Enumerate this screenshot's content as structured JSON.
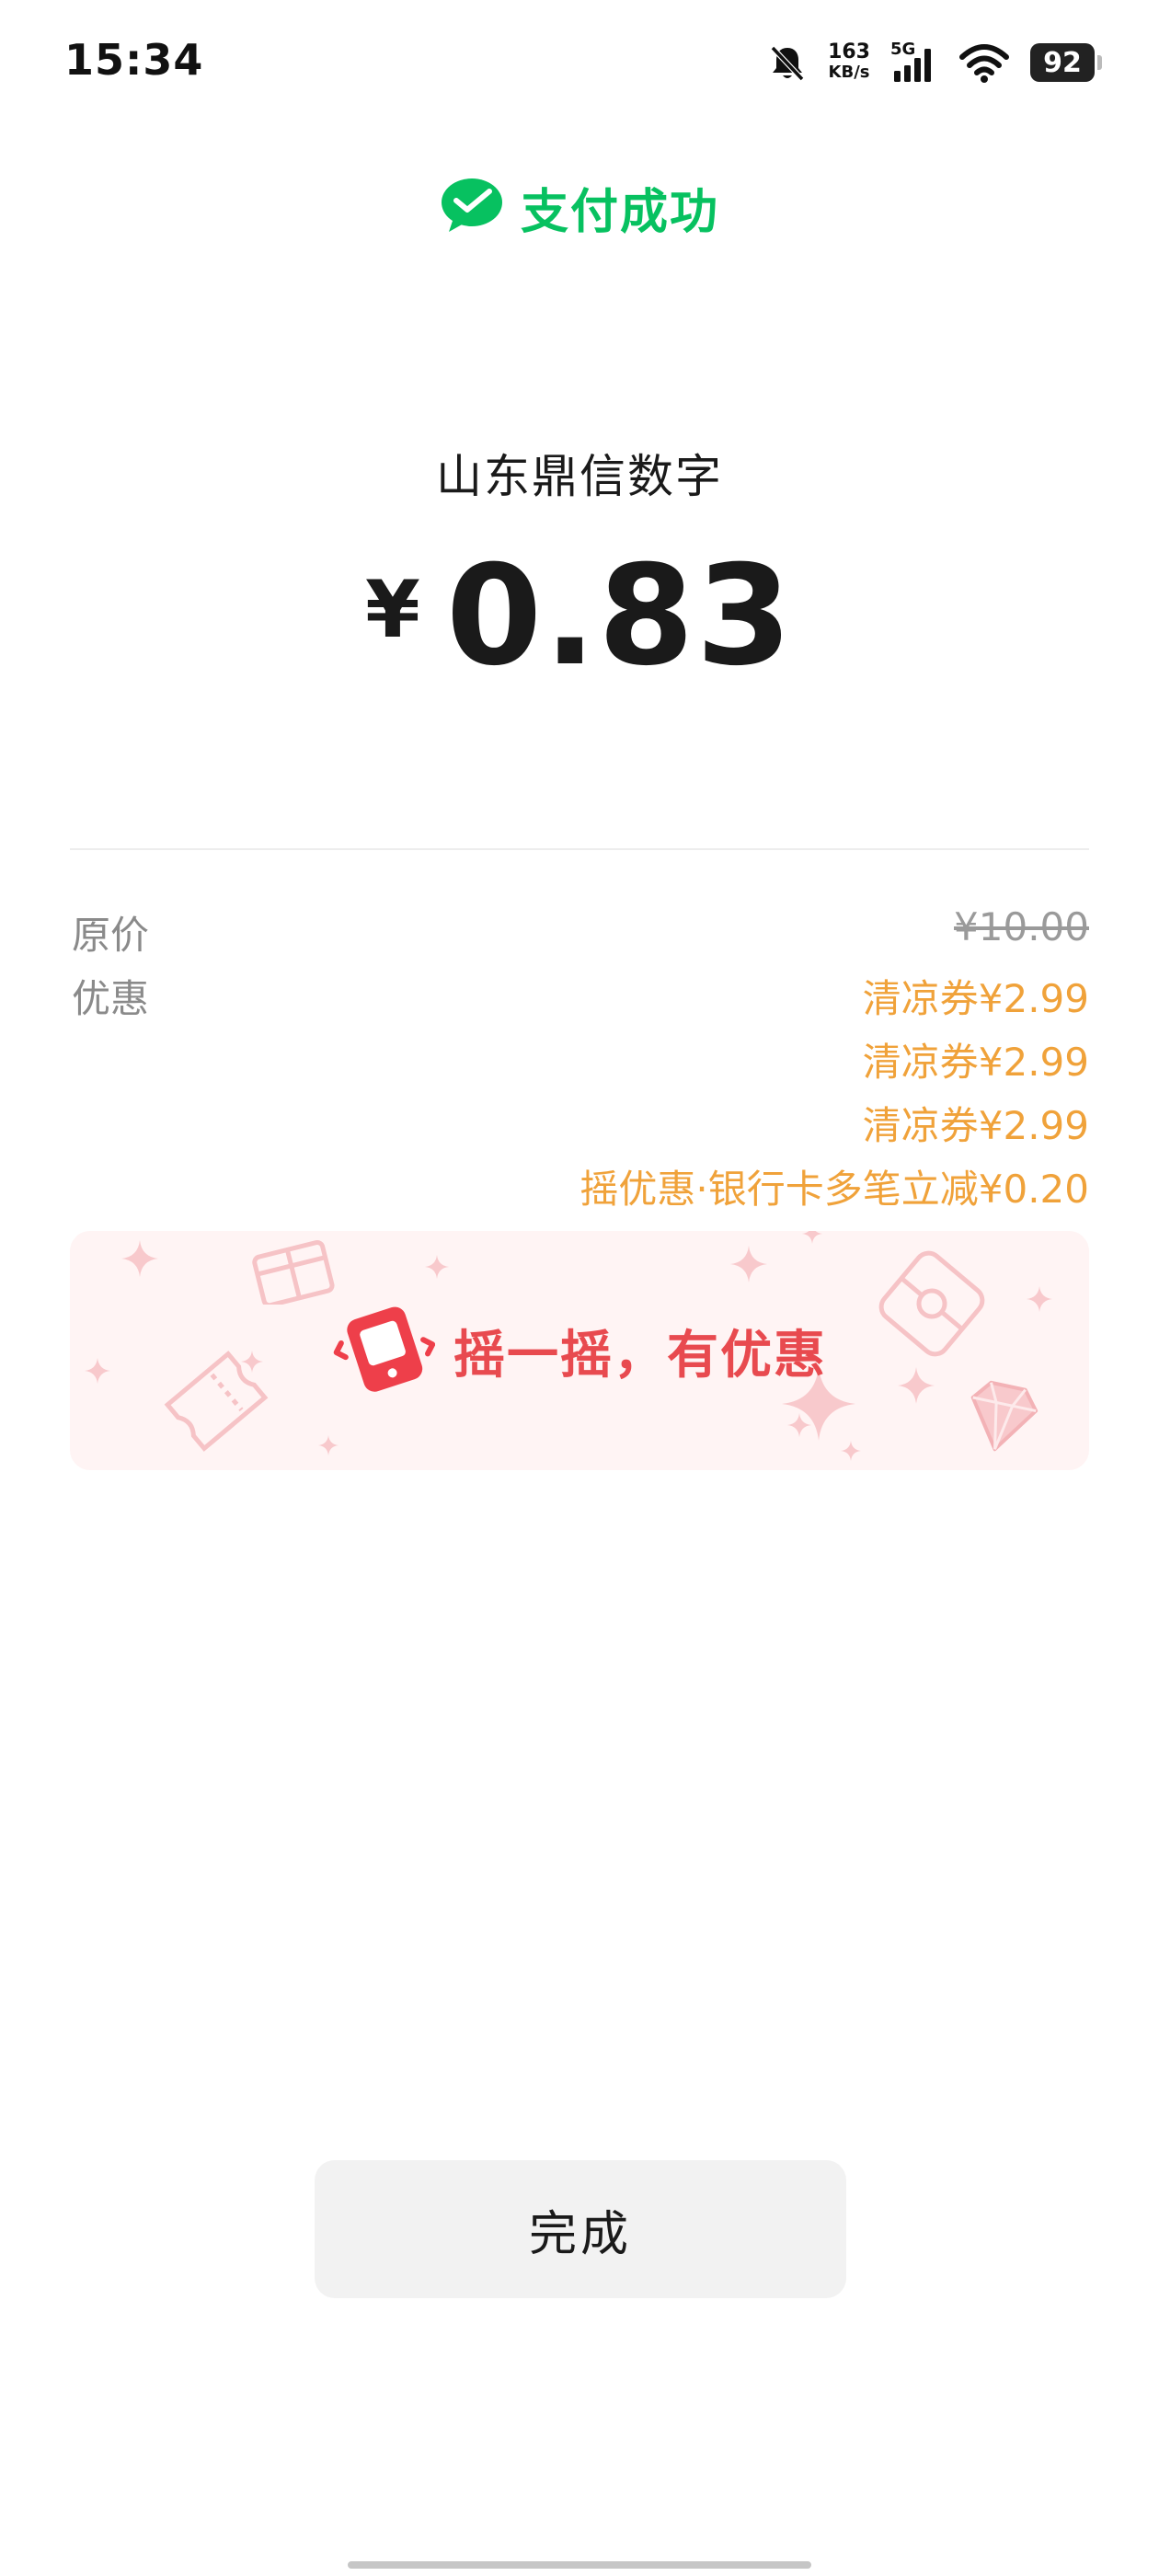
{
  "status_bar": {
    "time": "15:34",
    "net_speed_value": "163",
    "net_speed_unit": "KB/s",
    "network_type": "5G",
    "battery_level": "92",
    "icons": [
      "bell-muted-icon",
      "signal-icon",
      "wifi-icon",
      "battery-icon"
    ]
  },
  "header": {
    "status_text": "支付成功",
    "icon": "wechat-pay-icon",
    "accent_color": "#07c160"
  },
  "merchant": {
    "name": "山东鼎信数字"
  },
  "payment": {
    "currency_symbol": "¥",
    "amount": "0.83"
  },
  "details": {
    "original_price_label": "原价",
    "original_price_value": "¥10.00",
    "discount_label": "优惠",
    "discounts": [
      "清凉券¥2.99",
      "清凉券¥2.99",
      "清凉券¥2.99",
      "摇优惠·银行卡多笔立减¥0.20"
    ],
    "discount_color": "#f0a23a"
  },
  "shake_banner": {
    "text": "摇一摇，有优惠",
    "icon": "shake-phone-icon",
    "text_color": "#e84a4f",
    "background_color": "#fff4f4"
  },
  "actions": {
    "done_label": "完成"
  }
}
